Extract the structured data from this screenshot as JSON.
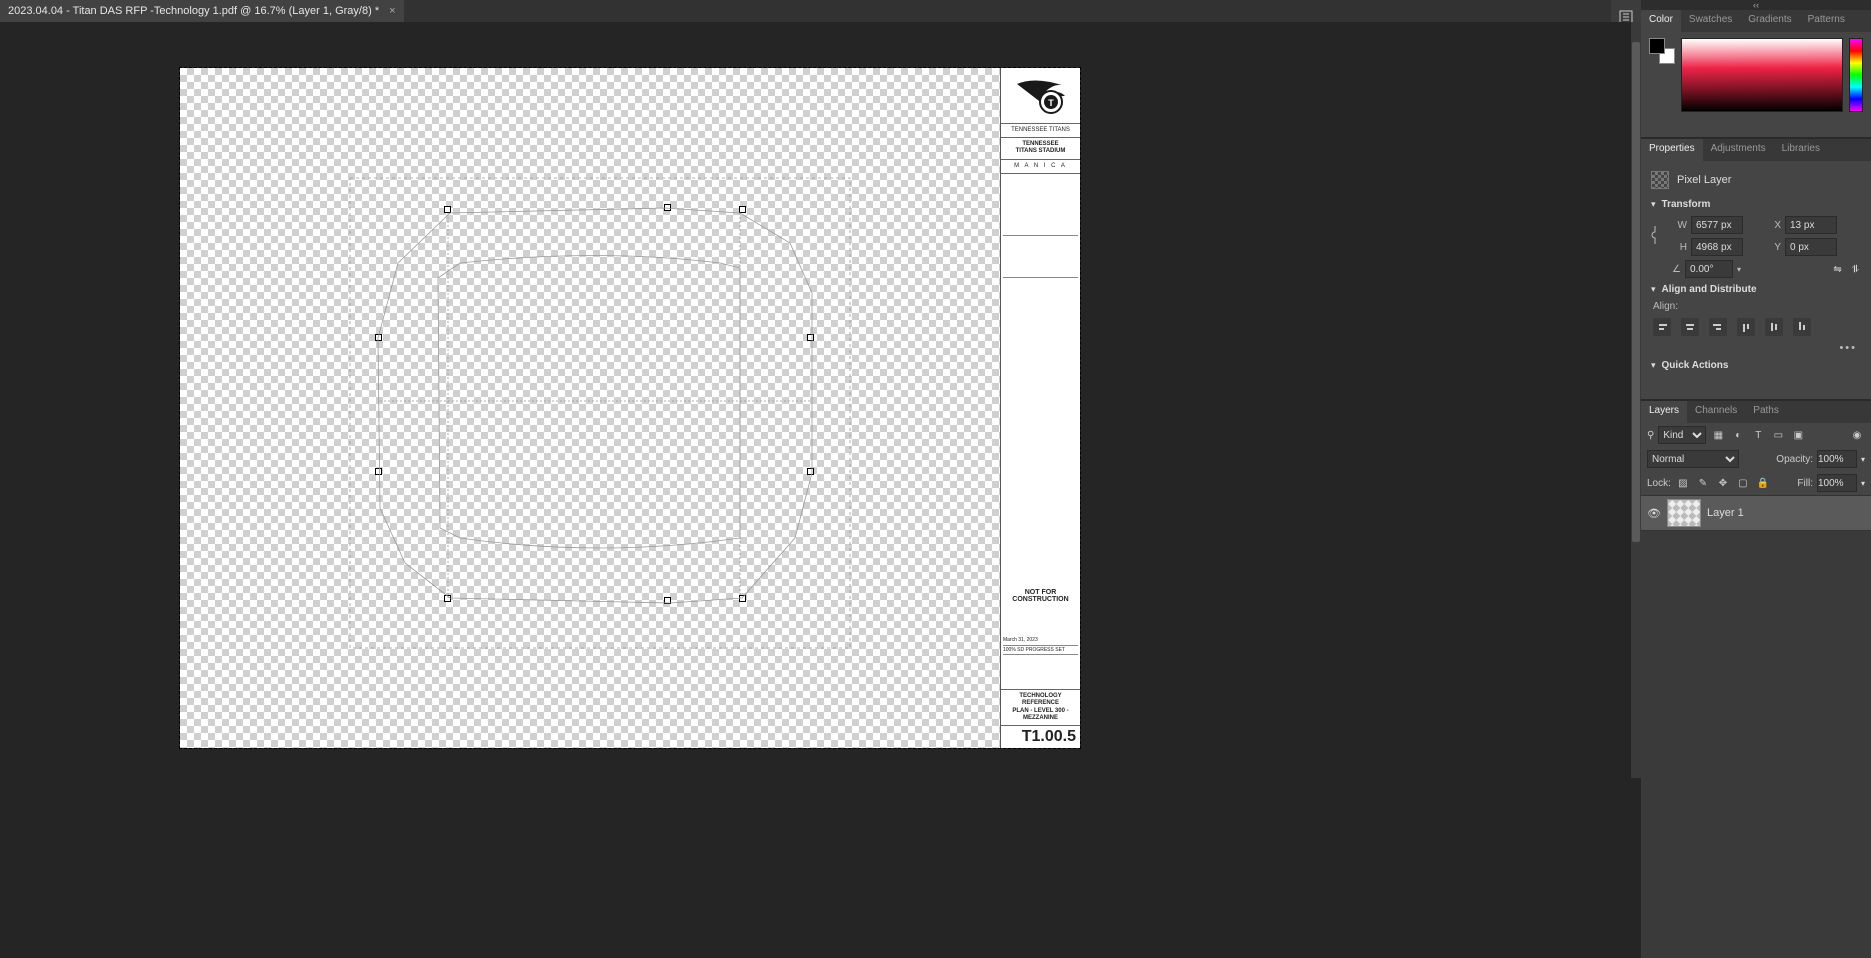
{
  "document": {
    "tab_title": "2023.04.04 - Titan DAS RFP -Technology 1.pdf @ 16.7% (Layer 1, Gray/8) *"
  },
  "title_block": {
    "org": "TENNESSEE TITANS",
    "project_line1": "TENNESSEE",
    "project_line2": "TITANS STADIUM",
    "architect": "M A N I C A",
    "flag1": "NOT FOR",
    "flag2": "CONSTRUCTION",
    "date": "March 31, 2023",
    "progress": "100% SD PROGRESS SET",
    "sheet_title1": "TECHNOLOGY REFERENCE",
    "sheet_title2": "PLAN - LEVEL 300 -",
    "sheet_title3": "MEZZANINE",
    "sheet_no": "T1.00.5"
  },
  "color_panel": {
    "tabs": {
      "color": "Color",
      "swatches": "Swatches",
      "gradients": "Gradients",
      "patterns": "Patterns"
    }
  },
  "properties_panel": {
    "tabs": {
      "properties": "Properties",
      "adjustments": "Adjustments",
      "libraries": "Libraries"
    },
    "layer_type": "Pixel Layer",
    "sections": {
      "transform": "Transform",
      "align": "Align and Distribute",
      "quick": "Quick Actions"
    },
    "align_label": "Align:",
    "transform": {
      "w_label": "W",
      "w": "6577 px",
      "h_label": "H",
      "h": "4968 px",
      "x_label": "X",
      "x": "13 px",
      "y_label": "Y",
      "y": "0 px",
      "angle_label": "△",
      "angle": "0.00°"
    }
  },
  "layers_panel": {
    "tabs": {
      "layers": "Layers",
      "channels": "Channels",
      "paths": "Paths"
    },
    "filter_label": "Kind",
    "blend": {
      "mode": "Normal",
      "opacity_label": "Opacity:",
      "opacity": "100%",
      "fill_label": "Fill:",
      "fill": "100%"
    },
    "lock_label": "Lock:",
    "layers": [
      {
        "name": "Layer 1",
        "visible": true
      }
    ]
  }
}
